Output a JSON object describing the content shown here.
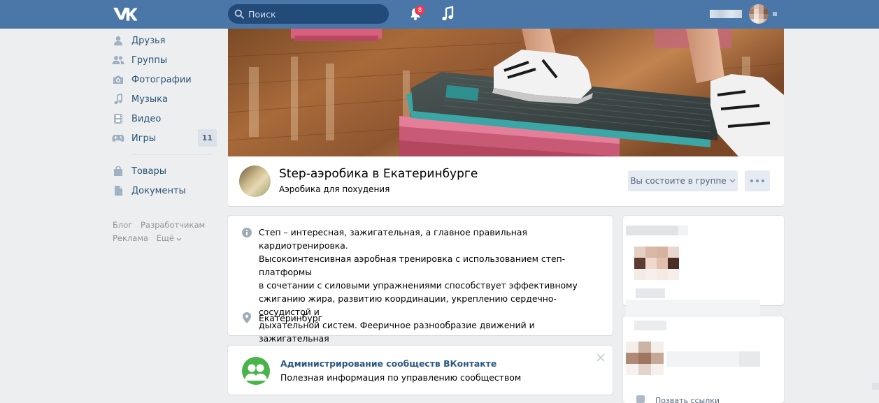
{
  "header": {
    "search_placeholder": "Поиск",
    "notifications_count": "8"
  },
  "sidebar": {
    "items": [
      {
        "label": "Друзья",
        "icon": "user-icon"
      },
      {
        "label": "Группы",
        "icon": "users-icon"
      },
      {
        "label": "Фотографии",
        "icon": "camera-icon"
      },
      {
        "label": "Музыка",
        "icon": "music-note-icon"
      },
      {
        "label": "Видео",
        "icon": "film-icon"
      },
      {
        "label": "Игры",
        "icon": "gamepad-icon",
        "count": "11"
      }
    ],
    "items2": [
      {
        "label": "Товары",
        "icon": "shopping-bag-icon"
      },
      {
        "label": "Документы",
        "icon": "document-icon"
      }
    ],
    "footer": {
      "blog": "Блог",
      "developers": "Разработчикам",
      "ads": "Реклама",
      "more": "Ещё"
    }
  },
  "group": {
    "title": "Step-аэробика в Екатеринбурге",
    "status": "Аэробика для похудения",
    "member_button": "Вы состоите в группе",
    "description": "Степ – интересная, зажигательная, а главное правильная кардиотренировка.\nВысокоинтенсивная аэробная тренировка с использованием степ-платформы\nв сочетании с силовыми упражнениями способствует эффективному\nсжиганию жира, развитию координации, укреплению сердечно-сосудистой и\nдыхательной систем. Фееричное разнообразие движений и зажигательная\nмузыка подарят вам море позитивной энергетики и подтянутую фигуру.",
    "location": "Екатеринбург"
  },
  "admin_tip": {
    "title": "Администрирование сообществ ВКонтакте",
    "subtitle": "Полезная информация по управлению сообществом"
  },
  "right_column": {
    "bottom_link": "Позвать ссылки"
  },
  "colors": {
    "header": "#4a76a8",
    "background": "#edeef0",
    "link": "#2a5885",
    "admin_avatar": "#4bb34b",
    "badge": "#ff3347"
  }
}
